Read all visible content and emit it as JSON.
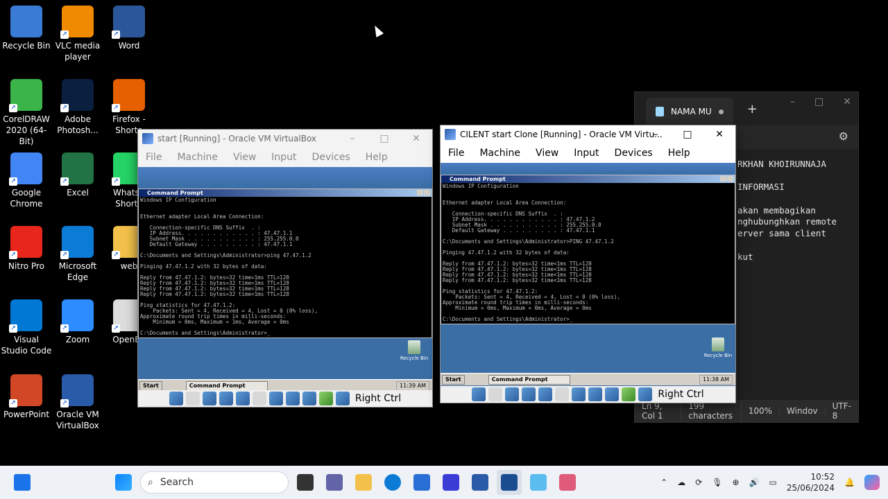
{
  "desktop_icons": [
    {
      "label": "Recycle Bin",
      "icon": "recycle-bin-icon",
      "color": "#3a7bd5"
    },
    {
      "label": "VLC media player",
      "icon": "vlc-icon",
      "color": "#f08a00"
    },
    {
      "label": "Word",
      "icon": "word-icon",
      "color": "#2b579a"
    },
    {
      "label": "CorelDRAW 2020 (64-Bit)",
      "icon": "coreldraw-icon",
      "color": "#3bb54a"
    },
    {
      "label": "Adobe Photosh...",
      "icon": "photoshop-icon",
      "color": "#0b1f3f"
    },
    {
      "label": "Firefox - Shorto",
      "icon": "firefox-icon",
      "color": "#e66000"
    },
    {
      "label": "Google Chrome",
      "icon": "chrome-icon",
      "color": "#4285f4"
    },
    {
      "label": "Excel",
      "icon": "excel-icon",
      "color": "#217346"
    },
    {
      "label": "WhatsA Shorto",
      "icon": "whatsapp-icon",
      "color": "#25d366"
    },
    {
      "label": "Nitro Pro",
      "icon": "nitro-icon",
      "color": "#e8261c"
    },
    {
      "label": "Microsoft Edge",
      "icon": "edge-icon",
      "color": "#0c7bd6"
    },
    {
      "label": "web",
      "icon": "folder-icon",
      "color": "#f3c14b"
    },
    {
      "label": "Visual Studio Code",
      "icon": "vscode-icon",
      "color": "#0078d4"
    },
    {
      "label": "Zoom",
      "icon": "zoom-icon",
      "color": "#2d8cff"
    },
    {
      "label": "OpenBo",
      "icon": "openboard-icon",
      "color": "#dddddd"
    },
    {
      "label": "PowerPoint",
      "icon": "powerpoint-icon",
      "color": "#d24726"
    },
    {
      "label": "Oracle VM VirtualBox",
      "icon": "virtualbox-icon",
      "color": "#2a5ba8"
    }
  ],
  "notepad": {
    "tab_title": "NAMA MU",
    "lines": [
      "RKHAN KHOIRUNNAJA",
      "",
      "INFORMASI",
      "",
      "akan membagikan",
      "nghubunghkan remote",
      "erver sama client",
      "",
      "kut"
    ],
    "status": {
      "position": "Ln 9, Col 1",
      "chars": "199 characters",
      "zoom": "100%",
      "eol": "Windov",
      "encoding": "UTF-8"
    }
  },
  "vbox1": {
    "title": "start [Running] - Oracle VM VirtualBox",
    "menu": [
      "File",
      "Machine",
      "View",
      "Input",
      "Devices",
      "Help"
    ],
    "cmd_title": "Command Prompt",
    "cmd_lines": [
      "Windows IP Configuration",
      "",
      "",
      "Ethernet adapter Local Area Connection:",
      "",
      "   Connection-specific DNS Suffix  . :",
      "   IP Address. . . . . . . . . . . . : 47.47.1.1",
      "   Subnet Mask . . . . . . . . . . . : 255.255.0.0",
      "   Default Gateway . . . . . . . . . : 47.47.1.1",
      "",
      "C:\\Documents and Settings\\Administrator>ping 47.47.1.2",
      "",
      "Pinging 47.47.1.2 with 32 bytes of data:",
      "",
      "Reply from 47.47.1.2: bytes=32 time=1ms TTL=128",
      "Reply from 47.47.1.2: bytes=32 time=1ms TTL=128",
      "Reply from 47.47.1.2: bytes=32 time=1ms TTL=128",
      "Reply from 47.47.1.2: bytes=32 time<1ms TTL=128",
      "",
      "Ping statistics for 47.47.1.2:",
      "    Packets: Sent = 4, Received = 4, Lost = 0 (0% loss),",
      "Approximate round trip times in milli-seconds:",
      "    Minimum = 0ms, Maximum = 1ms, Average = 0ms",
      "",
      "C:\\Documents and Settings\\Administrator>_"
    ],
    "recycle": "Recycle Bin",
    "start": "Start",
    "task": "Command Prompt",
    "clock": "11:39 AM",
    "host_key": "Right Ctrl"
  },
  "vbox2": {
    "title": "CILENT start Clone [Running] - Oracle VM Virtu...",
    "menu": [
      "File",
      "Machine",
      "View",
      "Input",
      "Devices",
      "Help"
    ],
    "cmd_title": "Command Prompt",
    "cmd_lines": [
      "Windows IP Configuration",
      "",
      "",
      "Ethernet adapter Local Area Connection:",
      "",
      "   Connection-specific DNS Suffix  . :",
      "   IP Address. . . . . . . . . . . . : 47.47.1.2",
      "   Subnet Mask . . . . . . . . . . . : 255.255.0.0",
      "   Default Gateway . . . . . . . . . : 47.47.1.1",
      "",
      "C:\\Documents and Settings\\Administrator>PING 47.47.1.2",
      "",
      "Pinging 47.47.1.2 with 32 bytes of data:",
      "",
      "Reply from 47.47.1.2: bytes=32 time<1ms TTL=128",
      "Reply from 47.47.1.2: bytes=32 time<1ms TTL=128",
      "Reply from 47.47.1.2: bytes=32 time<1ms TTL=128",
      "Reply from 47.47.1.2: bytes=32 time<1ms TTL=128",
      "",
      "Ping statistics for 47.47.1.2:",
      "    Packets: Sent = 4, Received = 4, Lost = 0 (0% loss),",
      "Approximate round trip times in milli-seconds:",
      "    Minimum = 0ms, Maximum = 0ms, Average = 0ms",
      "",
      "C:\\Documents and Settings\\Administrator>_"
    ],
    "recycle": "Recycle Bin",
    "start": "Start",
    "task": "Command Prompt",
    "clock": "11:38 AM",
    "host_key": "Right Ctrl"
  },
  "taskbar": {
    "search_placeholder": "Search",
    "time": "10:52",
    "date": "25/06/2024"
  }
}
